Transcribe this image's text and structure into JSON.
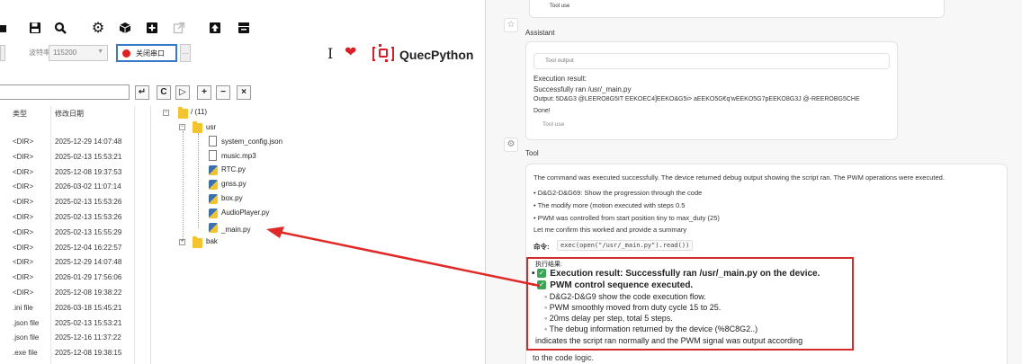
{
  "toolbar": {
    "icons": [
      "floppy-save",
      "search",
      "gear",
      "package",
      "plus-box",
      "external-link",
      "upload",
      "download"
    ]
  },
  "serial": {
    "baud_label": "波特率",
    "baud_value": "115200",
    "close_port_label": "关闭串口",
    "status_color": "#e02020"
  },
  "brand": {
    "name": "QuecPython",
    "accent": "#d81f26"
  },
  "file_table": {
    "headers": [
      "类型",
      "修改日期"
    ],
    "rows": [
      {
        "type": "<DIR>",
        "date": "2025-12-29 14:07:48"
      },
      {
        "type": "<DIR>",
        "date": "2025-02-13 15:53:21"
      },
      {
        "type": "<DIR>",
        "date": "2025-12-08 19:37:53"
      },
      {
        "type": "<DIR>",
        "date": "2026-03-02 11:07:14"
      },
      {
        "type": "<DIR>",
        "date": "2025-02-13 15:53:26"
      },
      {
        "type": "<DIR>",
        "date": "2025-02-13 15:53:26"
      },
      {
        "type": "<DIR>",
        "date": "2025-02-13 15:55:29"
      },
      {
        "type": "<DIR>",
        "date": "2025-12-04 16:22:57"
      },
      {
        "type": "<DIR>",
        "date": "2025-12-29 14:07:48"
      },
      {
        "type": "<DIR>",
        "date": "2026-01-29 17:56:06"
      },
      {
        "type": "<DIR>",
        "date": "2025-12-08 19:38:22"
      },
      {
        "type": ".ini file",
        "date": "2026-03-18 15:45:21"
      },
      {
        "type": ".json file",
        "date": "2025-02-13 15:53:21"
      },
      {
        "type": ".json file",
        "date": "2025-12-16 11:37:22"
      },
      {
        "type": ".exe file",
        "date": "2025-12-08 19:38:15"
      }
    ]
  },
  "tree": {
    "root": "/ (11)",
    "usr": "usr",
    "files": [
      "system_config.json",
      "music.mp3",
      "RTC.py",
      "gnss.py",
      "box.py",
      "AudioPlayer.py",
      "_main.py"
    ],
    "bak": "bak"
  },
  "chat": {
    "top_snippet": "Tool use",
    "assistant_meta": "Assistant",
    "tool_output_label": "Tool output",
    "exec_title": "Execution result:",
    "exec_line": "Successfully ran /usr/_main.py",
    "exec_output": "Output: 5D&G3 @LEERO8G5IT EEKOEC4]EEKO&G5i> aEEKO5G€q'wEEKO5G7pEEKO8G3J @-REEROBG5CHE",
    "exec_done": "Done!",
    "tool_used": "Tool use",
    "assistant_meta2": "Tool",
    "summary_intro": "The command was executed successfully. The device returned debug output showing the script ran. The PWM operations were executed.",
    "bullets": [
      "D&G2-D&G69: Show the progression through the code",
      "The modify more (motion executed with steps 0.5",
      "PWM was controlled from start position tiny to max_duty (25)"
    ],
    "confirm_line": "Let me confirm this worked and provide a summary",
    "command_label": "命令:",
    "command_code": "exec(open(\"/usr/_main.py\").read())",
    "result_header": "执行结果:",
    "result_lines": [
      "Execution result: Successfully ran /usr/_main.py on the device.",
      "PWM control sequence executed.",
      "D&G2-D&G9 show the code execution flow.",
      "PWM smoothly moved from duty cycle 15 to 25.",
      "20ms delay per step, total 5 steps.",
      "The debug information returned by the device (%8C8G2..)",
      "indicates the script ran normally and the PWM signal was output according",
      "to the code logic."
    ]
  }
}
